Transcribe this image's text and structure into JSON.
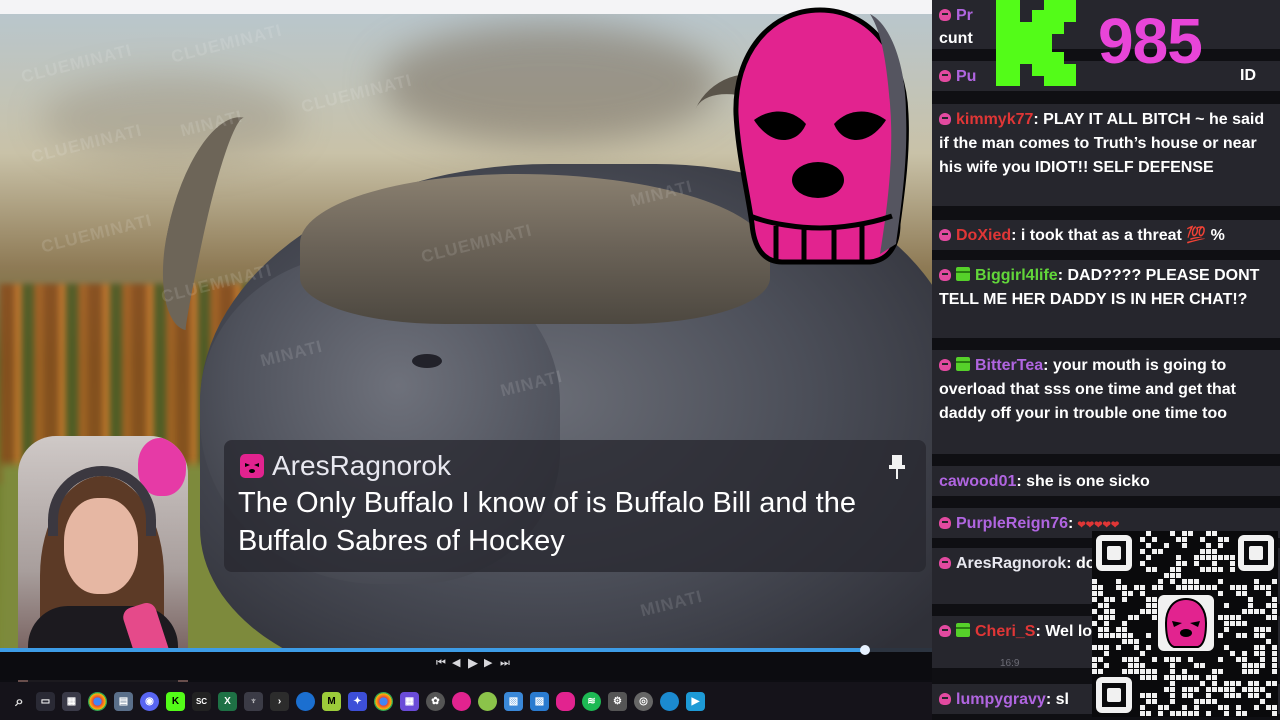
{
  "stream": {
    "viewer_count": "985",
    "id_label": "ID",
    "resolution_label": "16:9"
  },
  "watermarks": [
    "CLUEMINATI",
    "CLUEMINATI",
    "CLUEMINATI",
    "MINATI",
    "CLUEMINATI",
    "CLUEMINATI",
    "MINATI",
    "MINATI",
    "MINATI",
    "CLUEMINATI",
    "MINATI",
    "CLUEMINATI"
  ],
  "pinned": {
    "author": "AresRagnorok",
    "message": "The Only Buffalo I know of is Buffalo Bill and the Buffalo Sabres of Hockey"
  },
  "chat": {
    "messages": [
      {
        "user": "Pr",
        "user_color": "#b065e0",
        "badge": "mask",
        "text": ""
      },
      {
        "user": "",
        "user_color": "#ffffff",
        "badge": "",
        "text": "cunt"
      },
      {
        "user": "Pu",
        "user_color": "#b065e0",
        "badge": "mask",
        "text": ""
      },
      {
        "user": "kimmyk77",
        "user_color": "#e03636",
        "badge": "mask",
        "text": ": PLAY IT ALL BITCH ~ he said if the man comes to Truth’s house or near his wife you IDIOT!! SELF DEFENSE"
      },
      {
        "user": "DoXied",
        "user_color": "#e03636",
        "badge": "mask",
        "text": ": i took that as a threat 💯 %"
      },
      {
        "user": "Biggirl4life",
        "user_color": "#62d63a",
        "badge": "mask+gift",
        "text": ": DAD???? PLEASE DONT TELL ME HER DADDY IS IN HER CHAT!?"
      },
      {
        "user": "BitterTea",
        "user_color": "#b065e0",
        "badge": "mask+gift",
        "text": ": your mouth is going to overload that sss one time and get that daddy off your in trouble one time too"
      },
      {
        "user": "cawood01",
        "user_color": "#b065e0",
        "badge": "",
        "text": ": she is one sicko"
      },
      {
        "user": "PurpleReign76",
        "user_color": "#b065e0",
        "badge": "mask",
        "text": ":"
      },
      {
        "user": "AresRagnorok",
        "user_color": "#e8e8f0",
        "badge": "mask",
        "text": ": doing well in Hock"
      },
      {
        "user": "Cheri_S",
        "user_color": "#e03636",
        "badge": "mask+gift",
        "text": ": Wel lolcow"
      },
      {
        "user": "lumpygravy",
        "user_color": "#b065e0",
        "badge": "mask",
        "text": ": sl"
      }
    ]
  },
  "player": {
    "progress_fraction": 0.928
  },
  "taskbar": {
    "icons": [
      "search-icon",
      "window-icon",
      "task-icon",
      "chrome-icon",
      "calculator-icon",
      "discord-icon",
      "kick-icon",
      "sc-icon",
      "excel-icon",
      "vpn-icon",
      "terminal-icon",
      "edge-icon",
      "m-icon",
      "app-icon",
      "chrome2-icon",
      "grid-icon",
      "settings-icon",
      "mask-app-icon",
      "chat-icon",
      "pictures-icon",
      "photos-icon",
      "mask2-icon",
      "spotify-icon",
      "gear-icon",
      "globe-icon",
      "edge2-icon",
      "app2-icon"
    ],
    "labels": {
      "sc": "SC"
    }
  },
  "colors": {
    "accent_pink": "#e845d8",
    "kick_green": "#53fc18",
    "chat_bg": "#26262d"
  }
}
